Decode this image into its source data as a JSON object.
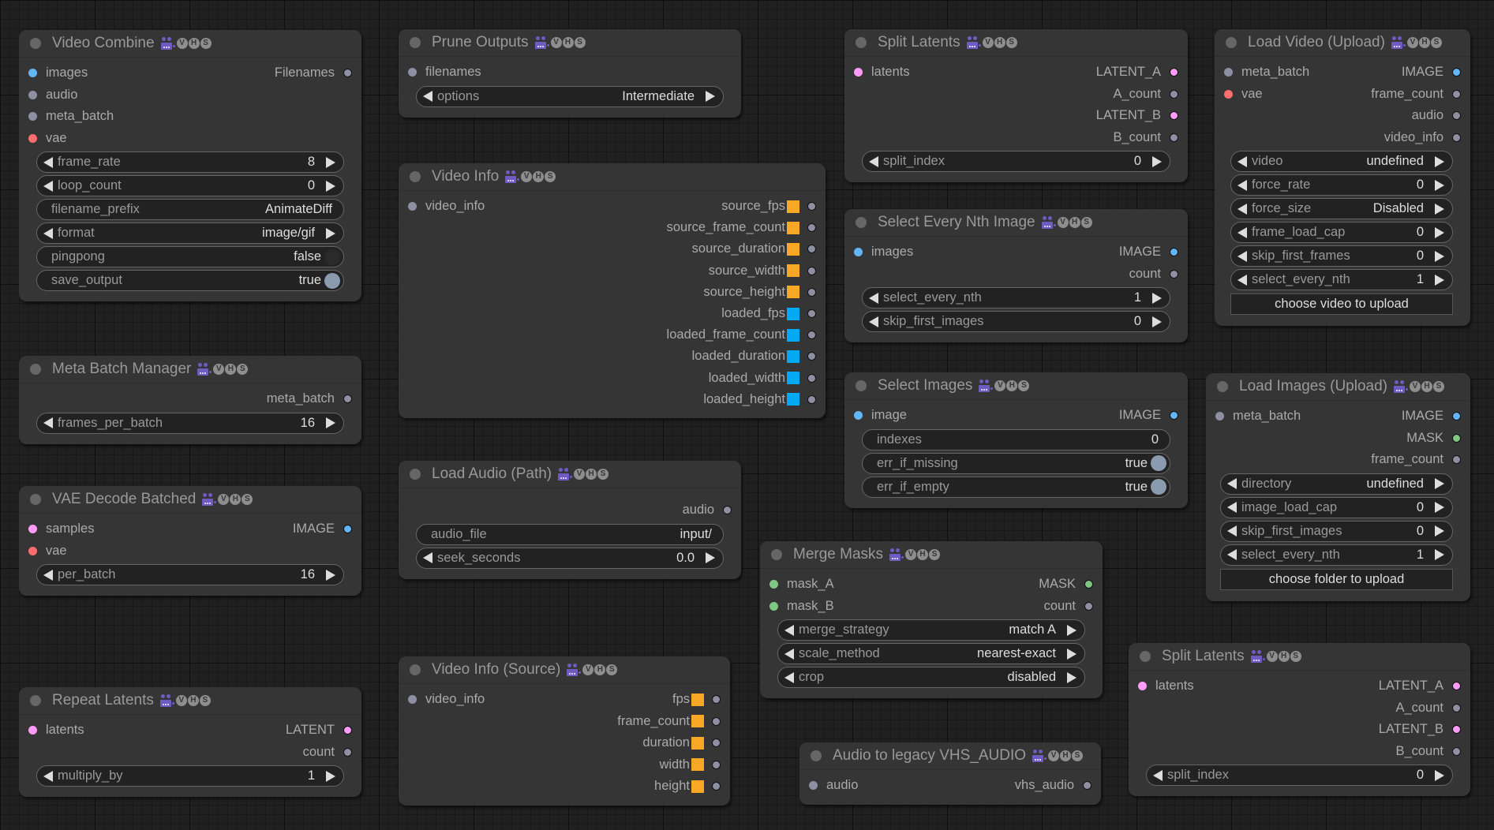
{
  "colors": {
    "image": "#64b5f6",
    "latent": "#ff9cf9",
    "vae": "#ff6e6e",
    "mask": "#81c784",
    "generic": "#8f8fa3",
    "float_square": "#f9a825",
    "int_square": "#03a9f4",
    "toggle_on": "#8a9bb0"
  },
  "badge": {
    "icon": "video-camera-icon",
    "letters": [
      "V",
      "H",
      "S"
    ]
  },
  "nodes": {
    "video_combine": {
      "title": "Video Combine",
      "inputs": [
        "images",
        "audio",
        "meta_batch",
        "vae"
      ],
      "outputs": [
        "Filenames"
      ],
      "widgets": [
        {
          "name": "frame_rate",
          "value": "8"
        },
        {
          "name": "loop_count",
          "value": "0"
        },
        {
          "name": "filename_prefix",
          "value": "AnimateDiff"
        },
        {
          "name": "format",
          "value": "image/gif"
        },
        {
          "name": "pingpong",
          "value": "false"
        },
        {
          "name": "save_output",
          "value": "true"
        }
      ]
    },
    "meta_batch_manager": {
      "title": "Meta Batch Manager",
      "outputs": [
        "meta_batch"
      ],
      "widgets": [
        {
          "name": "frames_per_batch",
          "value": "16"
        }
      ]
    },
    "vae_decode_batched": {
      "title": "VAE Decode Batched",
      "inputs": [
        "samples",
        "vae"
      ],
      "outputs": [
        "IMAGE"
      ],
      "widgets": [
        {
          "name": "per_batch",
          "value": "16"
        }
      ]
    },
    "repeat_latents": {
      "title": "Repeat Latents",
      "inputs": [
        "latents"
      ],
      "outputs": [
        "LATENT",
        "count"
      ],
      "widgets": [
        {
          "name": "multiply_by",
          "value": "1"
        }
      ]
    },
    "prune_outputs": {
      "title": "Prune Outputs",
      "inputs": [
        "filenames"
      ],
      "widgets": [
        {
          "name": "options",
          "value": "Intermediate"
        }
      ]
    },
    "video_info": {
      "title": "Video Info",
      "inputs": [
        "video_info"
      ],
      "outputs": [
        "source_fps",
        "source_frame_count",
        "source_duration",
        "source_width",
        "source_height",
        "loaded_fps",
        "loaded_frame_count",
        "loaded_duration",
        "loaded_width",
        "loaded_height"
      ]
    },
    "load_audio_path": {
      "title": "Load Audio (Path)",
      "outputs": [
        "audio"
      ],
      "widgets": [
        {
          "name": "audio_file",
          "value": "input/"
        },
        {
          "name": "seek_seconds",
          "value": "0.0"
        }
      ]
    },
    "video_info_source": {
      "title": "Video Info (Source)",
      "inputs": [
        "video_info"
      ],
      "outputs": [
        "fps",
        "frame_count",
        "duration",
        "width",
        "height"
      ]
    },
    "split_latents_top": {
      "title": "Split Latents",
      "inputs": [
        "latents"
      ],
      "outputs": [
        "LATENT_A",
        "A_count",
        "LATENT_B",
        "B_count"
      ],
      "widgets": [
        {
          "name": "split_index",
          "value": "0"
        }
      ]
    },
    "select_every_nth": {
      "title": "Select Every Nth Image",
      "inputs": [
        "images"
      ],
      "outputs": [
        "IMAGE",
        "count"
      ],
      "widgets": [
        {
          "name": "select_every_nth",
          "value": "1"
        },
        {
          "name": "skip_first_images",
          "value": "0"
        }
      ]
    },
    "select_images": {
      "title": "Select Images",
      "inputs": [
        "image"
      ],
      "outputs": [
        "IMAGE"
      ],
      "widgets": [
        {
          "name": "indexes",
          "value": "0"
        },
        {
          "name": "err_if_missing",
          "value": "true"
        },
        {
          "name": "err_if_empty",
          "value": "true"
        }
      ]
    },
    "merge_masks": {
      "title": "Merge Masks",
      "inputs": [
        "mask_A",
        "mask_B"
      ],
      "outputs": [
        "MASK",
        "count"
      ],
      "widgets": [
        {
          "name": "merge_strategy",
          "value": "match A"
        },
        {
          "name": "scale_method",
          "value": "nearest-exact"
        },
        {
          "name": "crop",
          "value": "disabled"
        }
      ]
    },
    "audio_to_legacy": {
      "title": "Audio to legacy VHS_AUDIO",
      "inputs": [
        "audio"
      ],
      "outputs": [
        "vhs_audio"
      ]
    },
    "load_video_upload": {
      "title": "Load Video (Upload)",
      "inputs": [
        "meta_batch",
        "vae"
      ],
      "outputs": [
        "IMAGE",
        "frame_count",
        "audio",
        "video_info"
      ],
      "widgets": [
        {
          "name": "video",
          "value": "undefined"
        },
        {
          "name": "force_rate",
          "value": "0"
        },
        {
          "name": "force_size",
          "value": "Disabled"
        },
        {
          "name": "frame_load_cap",
          "value": "0"
        },
        {
          "name": "skip_first_frames",
          "value": "0"
        },
        {
          "name": "select_every_nth",
          "value": "1"
        }
      ],
      "upload_label": "choose video to upload"
    },
    "load_images_upload": {
      "title": "Load Images (Upload)",
      "inputs": [
        "meta_batch"
      ],
      "outputs": [
        "IMAGE",
        "MASK",
        "frame_count"
      ],
      "widgets": [
        {
          "name": "directory",
          "value": "undefined"
        },
        {
          "name": "image_load_cap",
          "value": "0"
        },
        {
          "name": "skip_first_images",
          "value": "0"
        },
        {
          "name": "select_every_nth",
          "value": "1"
        }
      ],
      "upload_label": "choose folder to upload"
    },
    "split_latents_bottom": {
      "title": "Split Latents",
      "inputs": [
        "latents"
      ],
      "outputs": [
        "LATENT_A",
        "A_count",
        "LATENT_B",
        "B_count"
      ],
      "widgets": [
        {
          "name": "split_index",
          "value": "0"
        }
      ]
    }
  }
}
